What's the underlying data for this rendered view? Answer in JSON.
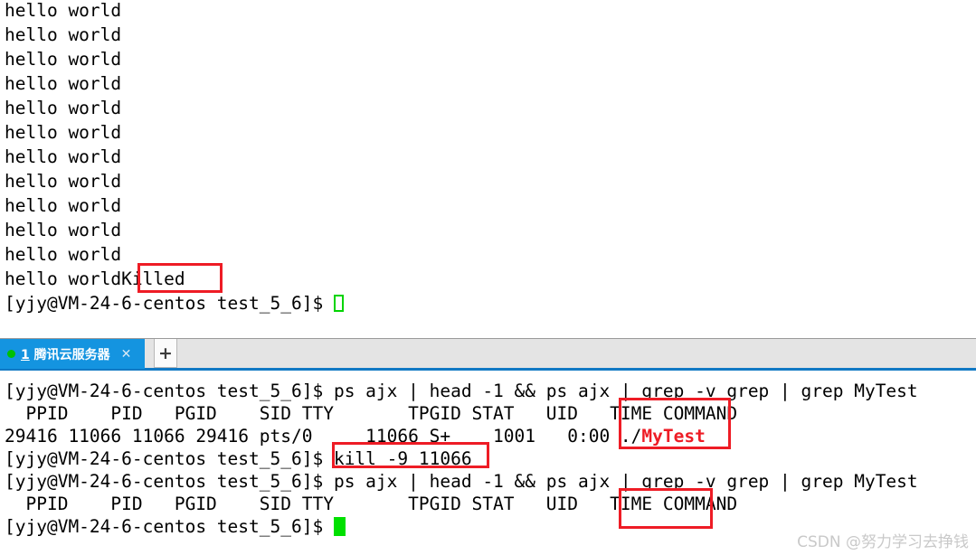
{
  "top_terminal": {
    "name": "top-terminal-pane",
    "output_lines": [
      "hello world",
      "hello world",
      "hello world",
      "hello world",
      "hello world",
      "hello world",
      "hello world",
      "hello world",
      "hello world",
      "hello world",
      "hello world"
    ],
    "killed_line_prefix": "hello world",
    "killed_text": "Killed",
    "prompt": "[yjy@VM-24-6-centos test_5_6]$ ",
    "cursor_style": "hollow-green-outline"
  },
  "tabbar": {
    "tab": {
      "index_label": "1",
      "title": "腾讯云服务器",
      "full_label": "1 腾讯云服务器",
      "status_dot_color": "#00c000",
      "close_glyph": "✕",
      "background": "#1494e0"
    },
    "new_tab_glyph": "+",
    "background": "#e4e4e4",
    "accent_underline": "#1179c4"
  },
  "bottom_terminal": {
    "name": "bottom-terminal-pane",
    "prompt": "[yjy@VM-24-6-centos test_5_6]$ ",
    "lines": [
      {
        "type": "prompt-command",
        "prompt": "[yjy@VM-24-6-centos test_5_6]$ ",
        "command": "ps ajx | head -1 && ps ajx | grep -v grep | grep MyTest"
      },
      {
        "type": "ps-header",
        "text": "  PPID    PID   PGID    SID TTY       TPGID STAT   UID   TIME COMMAND"
      },
      {
        "type": "ps-row",
        "text_plain": "29416 11066 11066 29416 pts/0     11066 S+    1001   0:00 ",
        "command_prefix": "./",
        "command_match": "MyTest"
      },
      {
        "type": "prompt-command",
        "prompt": "[yjy@VM-24-6-centos test_5_6]$ ",
        "command": "kill -9 11066"
      },
      {
        "type": "prompt-command",
        "prompt": "[yjy@VM-24-6-centos test_5_6]$ ",
        "command": "ps ajx | head -1 && ps ajx | grep -v grep | grep MyTest"
      },
      {
        "type": "ps-header",
        "text": "  PPID    PID   PGID    SID TTY       TPGID STAT   UID   TIME COMMAND"
      },
      {
        "type": "prompt-cursor",
        "prompt": "[yjy@VM-24-6-centos test_5_6]$ "
      }
    ],
    "cursor_style": "solid-green-block"
  },
  "annotations": {
    "color": "#ee1c25",
    "boxes": [
      {
        "label": "killed-highlight",
        "target": "Killed"
      },
      {
        "label": "command-mytest-highlight",
        "target": "COMMAND ./MyTest"
      },
      {
        "label": "kill-command-highlight",
        "target": "kill -9 11066"
      },
      {
        "label": "command-empty-highlight",
        "target": "COMMAND"
      }
    ]
  },
  "watermark": {
    "text": "CSDN @努力学习去挣钱"
  }
}
